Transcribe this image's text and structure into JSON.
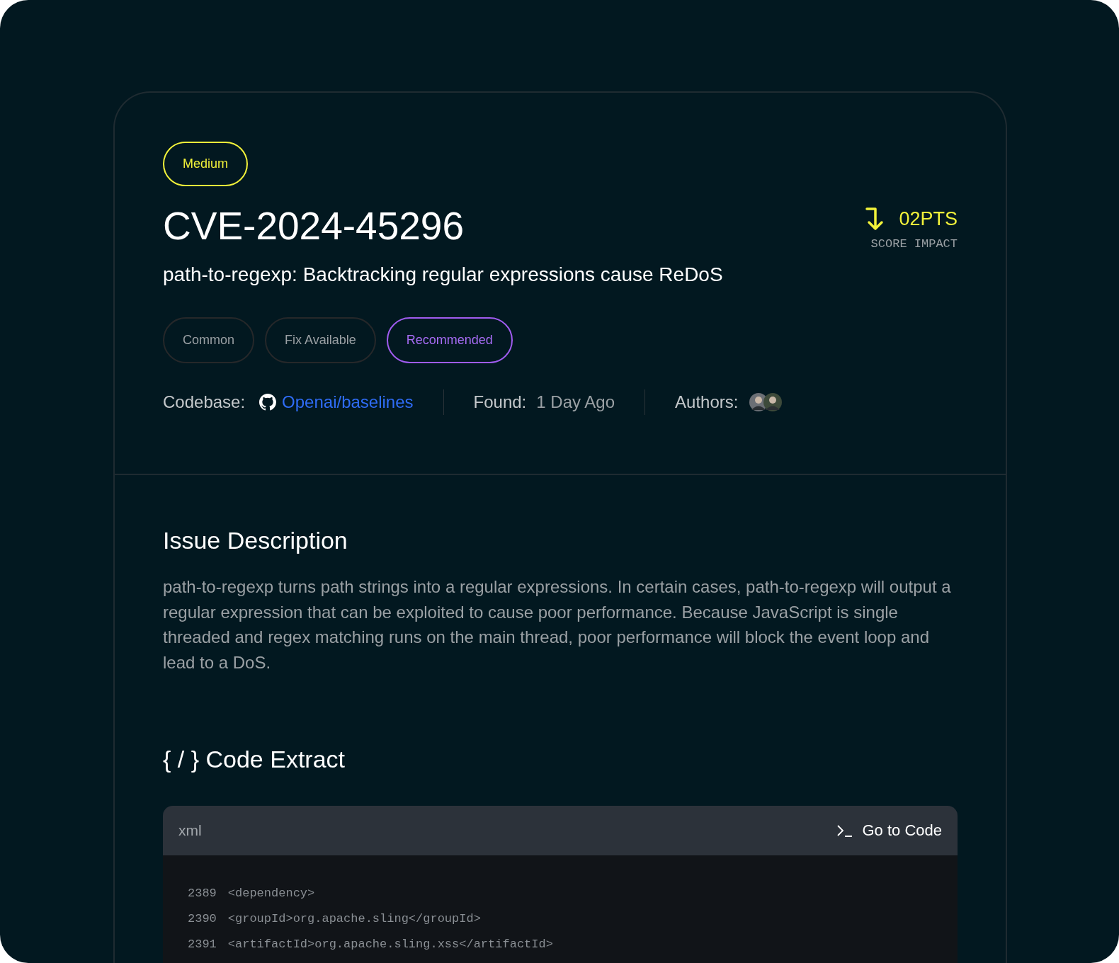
{
  "severity": {
    "label": "Medium",
    "color": "#f2f23a"
  },
  "cve_id": "CVE-2024-45296",
  "score": {
    "value": "02PTS",
    "label": "SCORE IMPACT"
  },
  "summary": "path-to-regexp: Backtracking regular expressions cause ReDoS",
  "tags": [
    {
      "label": "Common",
      "selected": false
    },
    {
      "label": "Fix Available",
      "selected": false
    },
    {
      "label": "Recommended",
      "selected": true
    }
  ],
  "meta": {
    "codebase_label": "Codebase:",
    "codebase": "Openai/baselines",
    "found_label": "Found:",
    "found": "1 Day Ago",
    "authors_label": "Authors:",
    "authors": [
      {
        "kind": "avatar"
      },
      {
        "kind": "avatar"
      }
    ]
  },
  "description": {
    "heading": "Issue Description",
    "text": "path-to-regexp turns path strings into a regular expressions. In certain cases, path-to-regexp will output a regular expression that can be exploited to cause poor performance. Because JavaScript is single threaded and regex matching runs on the main thread, poor performance will block the event loop and lead to a DoS."
  },
  "code": {
    "heading": "{ / } Code Extract",
    "language": "xml",
    "action": "Go to Code",
    "lines": [
      {
        "number": "2389",
        "text": "<dependency>"
      },
      {
        "number": "2390",
        "text": "<groupId>org.apache.sling</groupId>"
      },
      {
        "number": "2391",
        "text": "<artifactId>org.apache.sling.xss</artifactId>"
      }
    ]
  }
}
